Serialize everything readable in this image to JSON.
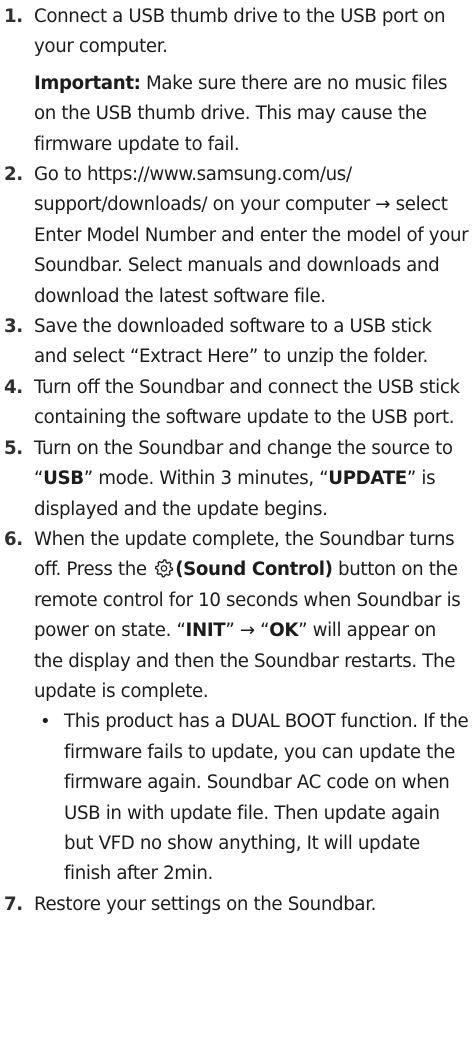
{
  "steps": [
    {
      "number": "1.",
      "text": "Connect a USB thumb drive to the USB port on your computer.",
      "note_label": "Important:",
      "note_text": " Make sure there are no music files on the USB thumb drive. This may cause the firmware update to fail."
    },
    {
      "number": "2.",
      "text": "Go to https://www.samsung.com/us/ support/downloads/ on your computer → select Enter Model Number and enter the model of your Soundbar. Select manuals and downloads and download the latest software file."
    },
    {
      "number": "3.",
      "text": "Save the downloaded software to a USB stick and select “Extract Here” to unzip the folder."
    },
    {
      "number": "4.",
      "text": "Turn off the Soundbar and connect the USB stick containing the software update to the USB port."
    },
    {
      "number": "5.",
      "t1": "Turn on the Soundbar and change the source to “",
      "b1": "USB",
      "t2": "” mode. Within 3 minutes, “",
      "b2": "UPDATE",
      "t3": "” is displayed and the update begins."
    },
    {
      "number": "6.",
      "t1": "When the update complete, the Soundbar turns off. Press the ",
      "icon": "gear-icon",
      "b1": "(Sound Control)",
      "t2": " button on the remote control for 10 seconds when Soundbar is power on state. “",
      "b2": "INIT",
      "t3": "” → “",
      "b3": "OK",
      "t4": "” will appear on the display and then the Soundbar restarts. The update is complete.",
      "bullet_mark": "•",
      "bullet_text": "This product has a DUAL BOOT function. If the firmware fails to update, you can update the firmware again. Soundbar AC code on when USB in with update file. Then update again but VFD no show anything, It will update finish after 2min."
    },
    {
      "number": "7.",
      "text": "Restore your settings on the Soundbar."
    }
  ]
}
